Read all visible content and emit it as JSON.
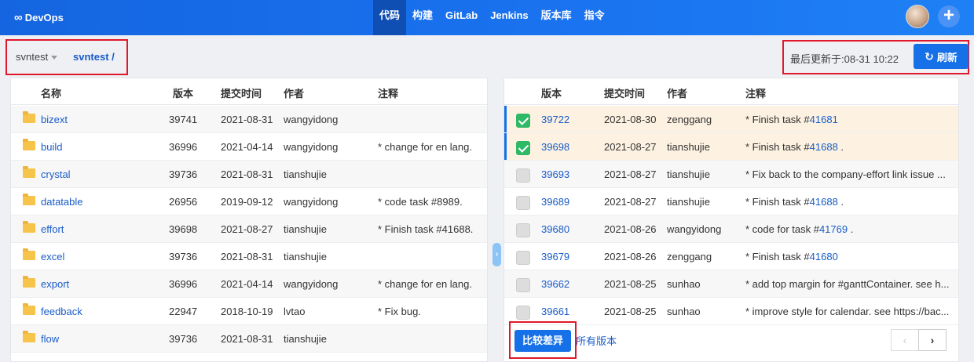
{
  "app": {
    "logo_symbol": "∞",
    "logo_text": "DevOps"
  },
  "nav": [
    {
      "label": "代码",
      "active": true
    },
    {
      "label": "构建",
      "active": false
    },
    {
      "label": "GitLab",
      "active": false
    },
    {
      "label": "Jenkins",
      "active": false
    },
    {
      "label": "版本库",
      "active": false
    },
    {
      "label": "指令",
      "active": false
    }
  ],
  "toolbar": {
    "repo": "svntest",
    "path": "svntest /",
    "updated_label": "最后更新于:",
    "updated_time": "08-31 10:22",
    "refresh_label": "刷新",
    "refresh_icon": "↻"
  },
  "files": {
    "headers": {
      "name": "名称",
      "revision": "版本",
      "time": "提交时间",
      "author": "作者",
      "comment": "注释"
    },
    "rows": [
      {
        "name": "bizext",
        "revision": "39741",
        "time": "2021-08-31",
        "author": "wangyidong",
        "comment": ""
      },
      {
        "name": "build",
        "revision": "36996",
        "time": "2021-04-14",
        "author": "wangyidong",
        "comment": "* change for en lang."
      },
      {
        "name": "crystal",
        "revision": "39736",
        "time": "2021-08-31",
        "author": "tianshujie",
        "comment": ""
      },
      {
        "name": "datatable",
        "revision": "26956",
        "time": "2019-09-12",
        "author": "wangyidong",
        "comment": "* code task #8989."
      },
      {
        "name": "effort",
        "revision": "39698",
        "time": "2021-08-27",
        "author": "tianshujie",
        "comment": "* Finish task #41688."
      },
      {
        "name": "excel",
        "revision": "39736",
        "time": "2021-08-31",
        "author": "tianshujie",
        "comment": ""
      },
      {
        "name": "export",
        "revision": "36996",
        "time": "2021-04-14",
        "author": "wangyidong",
        "comment": "* change for en lang."
      },
      {
        "name": "feedback",
        "revision": "22947",
        "time": "2018-10-19",
        "author": "lvtao",
        "comment": "* Fix bug."
      },
      {
        "name": "flow",
        "revision": "39736",
        "time": "2021-08-31",
        "author": "tianshujie",
        "comment": ""
      }
    ]
  },
  "revisions": {
    "headers": {
      "revision": "版本",
      "time": "提交时间",
      "author": "作者",
      "comment": "注释"
    },
    "rows": [
      {
        "checked": true,
        "revision": "39722",
        "time": "2021-08-30",
        "author": "zenggang",
        "comment": "* Finish task #",
        "link": "41681",
        "suffix": ""
      },
      {
        "checked": true,
        "revision": "39698",
        "time": "2021-08-27",
        "author": "tianshujie",
        "comment": "* Finish task #",
        "link": "41688",
        "suffix": " ."
      },
      {
        "checked": false,
        "revision": "39693",
        "time": "2021-08-27",
        "author": "tianshujie",
        "comment": "* Fix back to the company-effort link issue ...",
        "link": "",
        "suffix": ""
      },
      {
        "checked": false,
        "revision": "39689",
        "time": "2021-08-27",
        "author": "tianshujie",
        "comment": "* Finish task #",
        "link": "41688",
        "suffix": " ."
      },
      {
        "checked": false,
        "revision": "39680",
        "time": "2021-08-26",
        "author": "wangyidong",
        "comment": "* code for task #",
        "link": "41769",
        "suffix": " ."
      },
      {
        "checked": false,
        "revision": "39679",
        "time": "2021-08-26",
        "author": "zenggang",
        "comment": "* Finish task #",
        "link": "41680",
        "suffix": ""
      },
      {
        "checked": false,
        "revision": "39662",
        "time": "2021-08-25",
        "author": "sunhao",
        "comment": "* add top margin for #ganttContainer. see h...",
        "link": "",
        "suffix": ""
      },
      {
        "checked": false,
        "revision": "39661",
        "time": "2021-08-25",
        "author": "sunhao",
        "comment": "* improve style for calendar. see https://bac...",
        "link": "",
        "suffix": ""
      }
    ],
    "compare_label": "比较差异",
    "all_versions_label": "所有版本",
    "prev_icon": "‹",
    "next_icon": "›"
  },
  "colors": {
    "accent": "#1670e8",
    "highlight": "#e0182b",
    "checked_row": "#fdf2e1"
  }
}
